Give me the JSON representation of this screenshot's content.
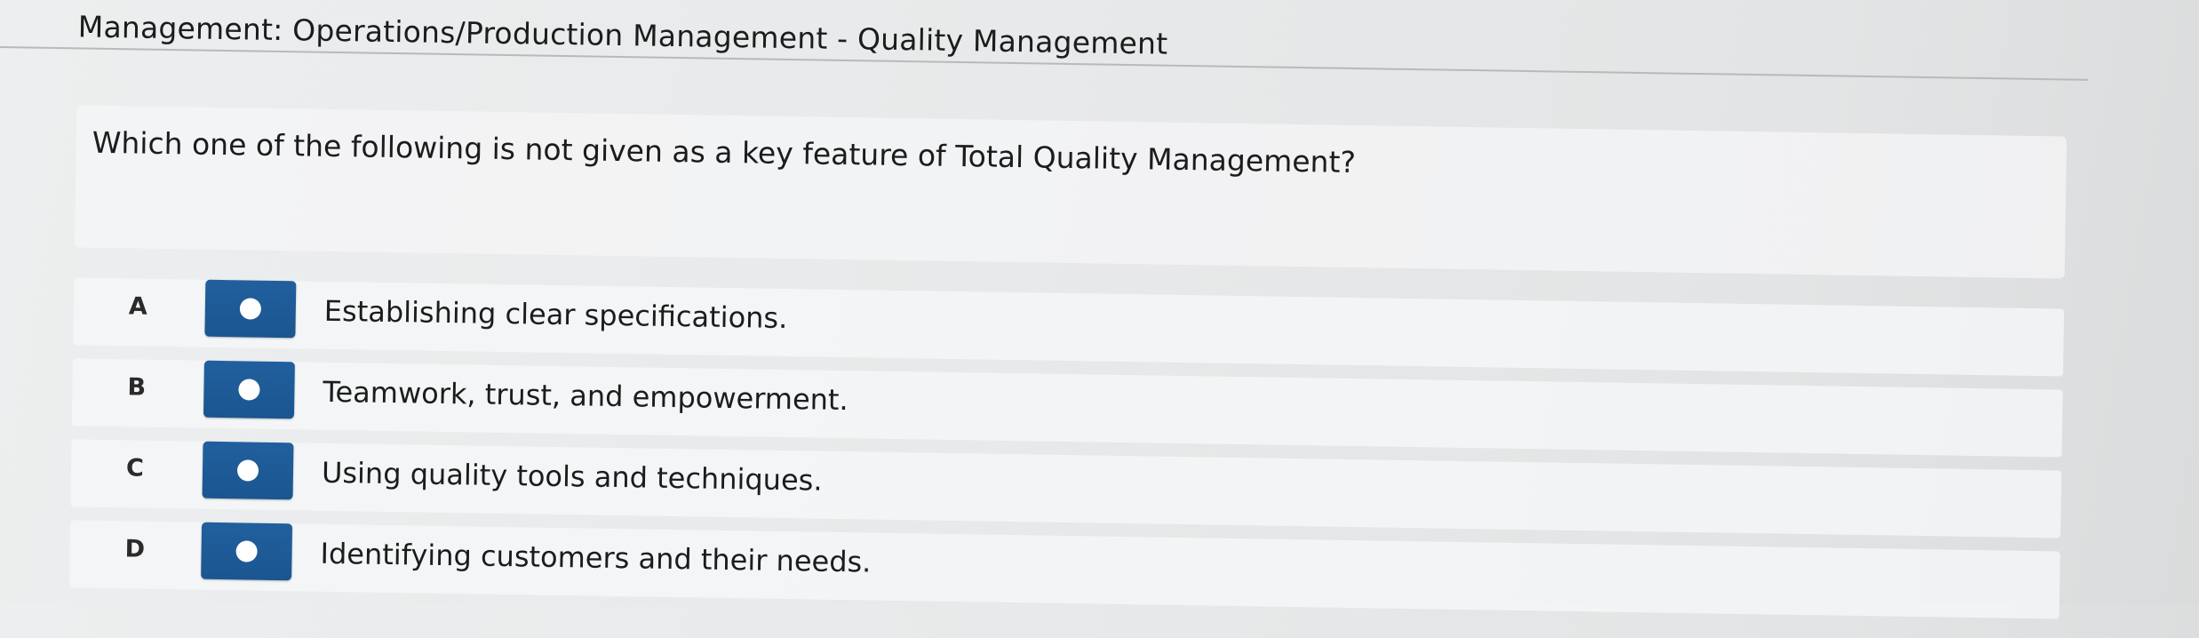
{
  "header": {
    "title": "Management: Operations/Production Management - Quality Management"
  },
  "question": {
    "text": "Which one of the following is not given as a key feature of Total Quality Management?"
  },
  "options": [
    {
      "letter": "A",
      "text": "Establishing clear specifications."
    },
    {
      "letter": "B",
      "text": "Teamwork, trust, and empowerment."
    },
    {
      "letter": "C",
      "text": "Using quality tools and techniques."
    },
    {
      "letter": "D",
      "text": "Identifying customers and their needs."
    }
  ],
  "colors": {
    "radio_button": "#1d5a96",
    "radio_dot": "#ffffff",
    "background": "#e7e9ea"
  },
  "icons": {
    "radio": "radio-unselected-icon"
  }
}
